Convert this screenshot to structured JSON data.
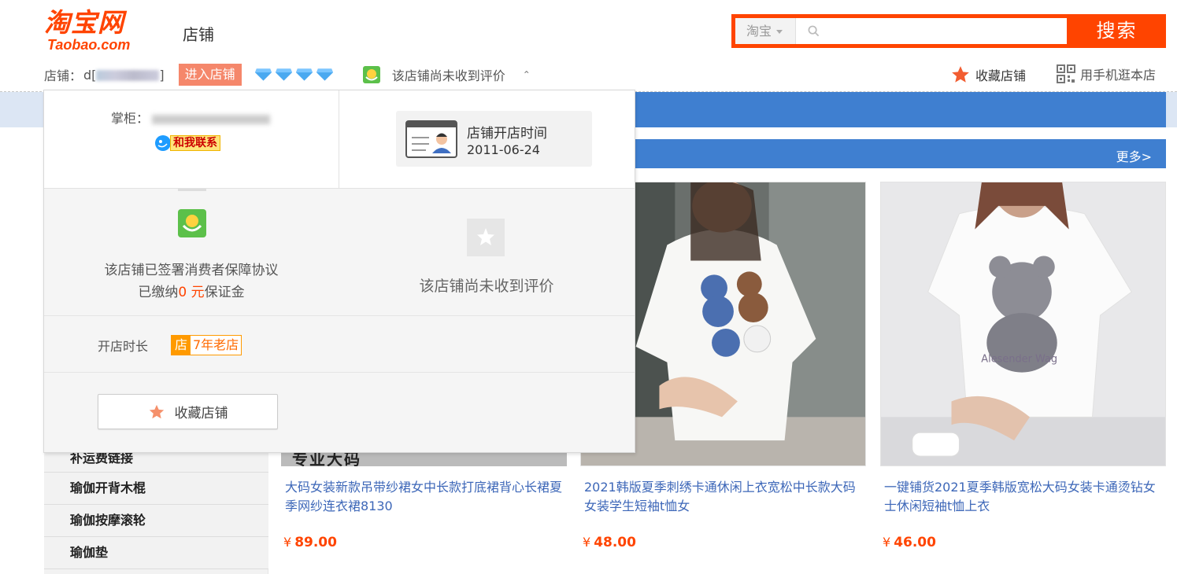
{
  "header": {
    "logo_cn": "淘宝网",
    "logo_en": "Taobao.com",
    "title": "店铺",
    "search": {
      "category": "淘宝",
      "placeholder": "",
      "button": "搜索"
    }
  },
  "shop_bar": {
    "shop_label": "店铺：",
    "shop_name_prefix": "d[",
    "shop_name_suffix": "]",
    "enter_button": "进入店铺",
    "diamond_count": 4,
    "rating_text": "该店铺尚未收到评价",
    "chevron": "⌃",
    "favorite": "收藏店铺",
    "mobile": "用手机逛本店"
  },
  "banner": {
    "more": "更多>"
  },
  "popup": {
    "keeper_label": "掌柜：",
    "contact": "和我联系",
    "open_label": "店铺开店时间",
    "open_date": "2011-06-24",
    "guarantee_line1": "该店铺已签署消费者保障协议",
    "guarantee_prefix": "已缴纳",
    "guarantee_amount": "0",
    "guarantee_unit": " 元",
    "guarantee_suffix": "保证金",
    "no_eval": "该店铺尚未收到评价",
    "age_label": "开店时长",
    "age_icon": "店",
    "age_text": "7年老店",
    "fav_button": "收藏店铺"
  },
  "sidebar": {
    "items": [
      "补运费链接",
      "瑜伽开背木棍",
      "瑜伽按摩滚轮",
      "瑜伽垫"
    ]
  },
  "products": [
    {
      "strip_text": "专业大码",
      "title": "大码女装新款吊带纱裙女中长款打底裙背心长裙夏季网纱连衣裙8130",
      "currency": "¥",
      "price": "89.00"
    },
    {
      "title": "2021韩版夏季刺绣卡通休闲上衣宽松中长款大码女装学生短袖t恤女",
      "currency": "¥",
      "price": "48.00"
    },
    {
      "title": "一键铺货2021夏季韩版宽松大码女装卡通烫钻女士休闲短袖t恤上衣",
      "currency": "¥",
      "price": "46.00",
      "print_text": "Alesender Wag"
    }
  ],
  "colors": {
    "brand": "#ff4400",
    "link": "#3d67b8",
    "banner": "#3f7fd0"
  }
}
